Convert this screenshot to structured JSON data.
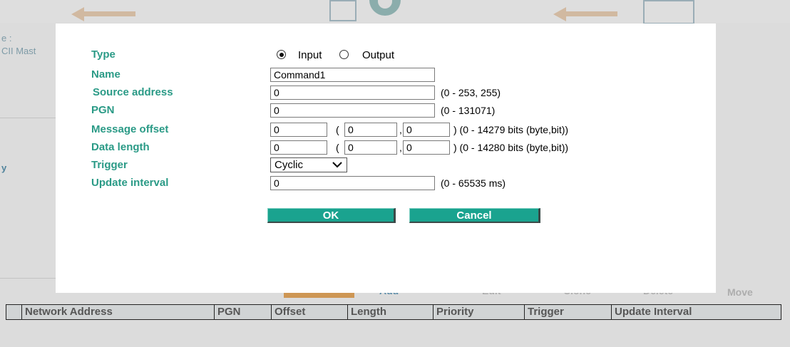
{
  "background": {
    "left_fragment_1": "e :",
    "left_fragment_2": "CII Mast",
    "left_fragment_3": "y",
    "toolbar": {
      "add": "Add",
      "edit": "Edit",
      "clone": "Clone",
      "delete": "Delete",
      "move": "Move"
    },
    "table_headers": [
      "Network Address",
      "PGN",
      "Offset",
      "Length",
      "Priority",
      "Trigger",
      "Update Interval"
    ]
  },
  "dialog": {
    "type_label": "Type",
    "type_options": [
      "Input",
      "Output"
    ],
    "type_selected": "Input",
    "name_label": "Name",
    "name_value": "Command1",
    "source_address_label": "Source address",
    "source_address_value": "0",
    "source_address_hint": "(0 - 253, 255)",
    "pgn_label": "PGN",
    "pgn_value": "0",
    "pgn_hint": "(0 - 131071)",
    "message_offset_label": "Message offset",
    "message_offset_value": "0",
    "message_offset_byte": "0",
    "message_offset_bit": "0",
    "message_offset_hint": ") (0 - 14279 bits (byte,bit))",
    "data_length_label": "Data length",
    "data_length_value": "0",
    "data_length_byte": "0",
    "data_length_bit": "0",
    "data_length_hint": ") (0 - 14280 bits (byte,bit))",
    "trigger_label": "Trigger",
    "trigger_value": "Cyclic",
    "update_interval_label": "Update interval",
    "update_interval_value": "0",
    "update_interval_hint": "(0 - 65535 ms)",
    "ok_label": "OK",
    "cancel_label": "Cancel",
    "open_paren": "(",
    "comma": ","
  },
  "colors": {
    "label_teal": "#2a9a86",
    "button_teal": "#1aa38f"
  },
  "icons": [
    "back-arrow-icon",
    "gear-icon",
    "device-icon",
    "radio-icon",
    "chevron-down-icon"
  ]
}
